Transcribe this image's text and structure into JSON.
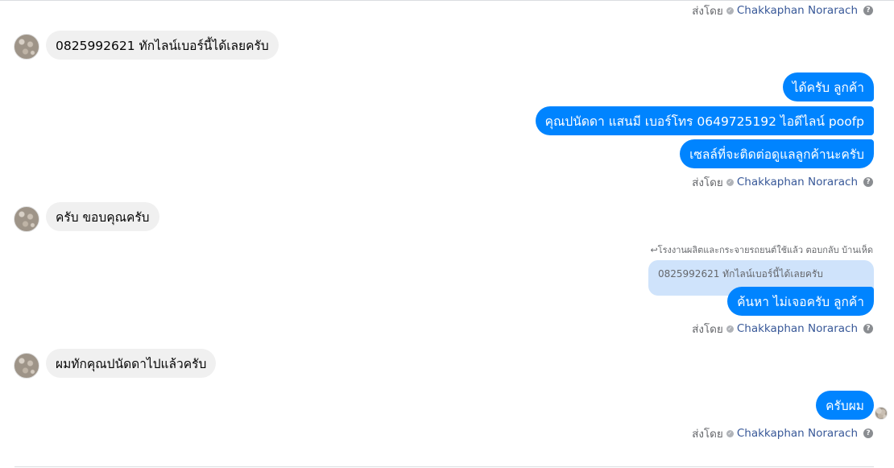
{
  "sent_by_prefix": "ส่งโดย",
  "sender_name": "Chakkaphan Norarach",
  "messages": {
    "in1": "0825992621 ทักไลน์เบอร์นี้ได้เลยครับ",
    "out1": "ได้ครับ ลูกค้า",
    "out2": "คุณปนัดดา แสนมี   เบอร์โทร 0649725192  ไอดีไลน์ poofp",
    "out3": "เซลล์ที่จะติดต่อดูแลลูกค้านะครับ",
    "in2": "ครับ ขอบคุณครับ",
    "reply_label": "โรงงานผลิตและกระจายรถยนต์ใช้แล้ว ตอบกลับ บ้านเห็ด",
    "reply_quote": "0825992621 ทักไลน์เบอร์นี้ได้เลยครับ",
    "out4": "ค้นหา ไม่เจอครับ ลูกค้า",
    "in3": "ผมทักคุณปนัดดาไปแล้วครับ",
    "out5": "ครับผม"
  },
  "colors": {
    "outgoing_bubble": "#0084ff",
    "incoming_bubble": "#f0f0f0",
    "reply_quote_bg": "#cfe3fb",
    "sender_link": "#385898"
  }
}
